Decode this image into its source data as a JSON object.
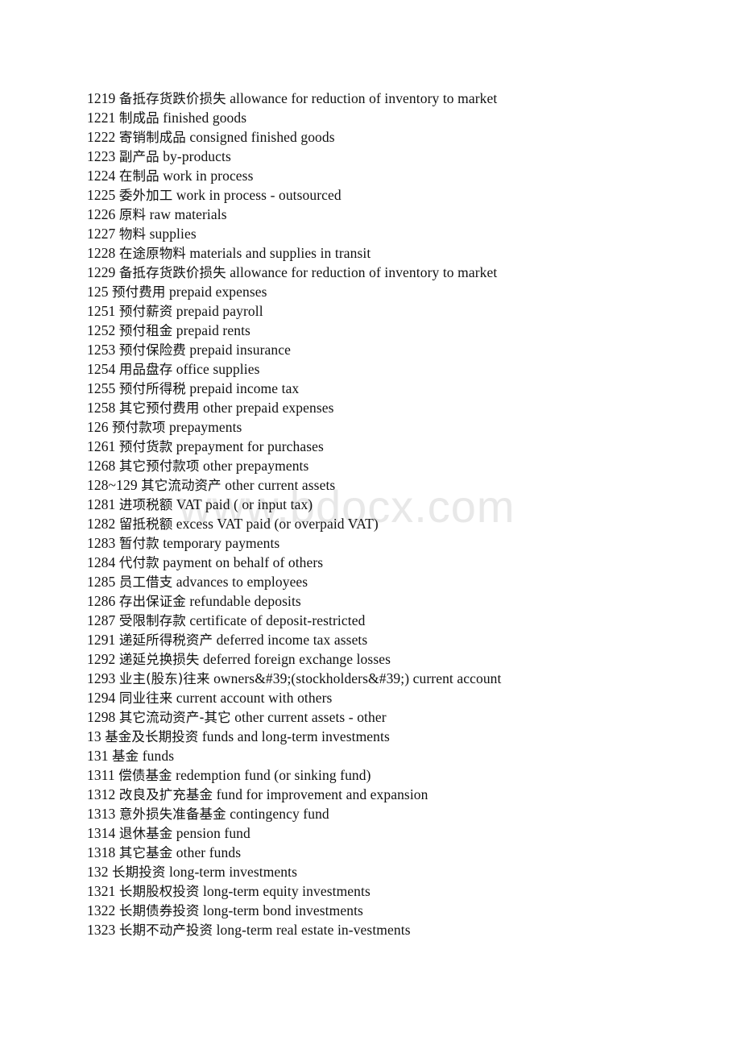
{
  "document": {
    "type": "accounting-chart-of-accounts-glossary",
    "language_pair": "Chinese-English",
    "watermark": {
      "text": "www.bdocx.com",
      "color": "#e8e8e8"
    },
    "entries": [
      {
        "code": "1219",
        "zh": "备抵存货跌价损失",
        "en": "allowance for reduction of inventory to market"
      },
      {
        "code": "1221",
        "zh": "制成品",
        "en": "finished goods"
      },
      {
        "code": "1222",
        "zh": "寄销制成品",
        "en": "consigned finished goods"
      },
      {
        "code": "1223",
        "zh": "副产品",
        "en": "by-products"
      },
      {
        "code": "1224",
        "zh": "在制品",
        "en": "work in process"
      },
      {
        "code": "1225",
        "zh": "委外加工",
        "en": "work in process - outsourced"
      },
      {
        "code": "1226",
        "zh": "原料",
        "en": "raw materials"
      },
      {
        "code": "1227",
        "zh": "物料",
        "en": "supplies"
      },
      {
        "code": "1228",
        "zh": "在途原物料",
        "en": "materials and supplies in transit"
      },
      {
        "code": "1229",
        "zh": "备抵存货跌价损失",
        "en": "allowance for reduction of inventory to market"
      },
      {
        "code": "125",
        "zh": "预付费用",
        "en": "prepaid expenses"
      },
      {
        "code": "1251",
        "zh": "预付薪资",
        "en": "prepaid payroll"
      },
      {
        "code": "1252",
        "zh": "预付租金",
        "en": "prepaid rents"
      },
      {
        "code": "1253",
        "zh": "预付保险费",
        "en": "prepaid insurance"
      },
      {
        "code": "1254",
        "zh": "用品盘存",
        "en": "office supplies"
      },
      {
        "code": "1255",
        "zh": "预付所得税",
        "en": "prepaid income tax"
      },
      {
        "code": "1258",
        "zh": "其它预付费用",
        "en": "other prepaid expenses"
      },
      {
        "code": "126",
        "zh": "预付款项",
        "en": "prepayments"
      },
      {
        "code": "1261",
        "zh": "预付货款",
        "en": "prepayment for purchases"
      },
      {
        "code": "1268",
        "zh": "其它预付款项",
        "en": "other prepayments"
      },
      {
        "code": "128~129",
        "zh": "其它流动资产",
        "en": "other current assets"
      },
      {
        "code": "1281",
        "zh": "进项税额",
        "en": "VAT paid ( or input tax)"
      },
      {
        "code": "1282",
        "zh": "留抵税额",
        "en": "excess VAT paid (or overpaid VAT)"
      },
      {
        "code": "1283",
        "zh": "暂付款",
        "en": "temporary payments"
      },
      {
        "code": "1284",
        "zh": "代付款",
        "en": "payment on behalf of others"
      },
      {
        "code": "1285",
        "zh": "员工借支",
        "en": "advances to employees"
      },
      {
        "code": "1286",
        "zh": "存出保证金",
        "en": "refundable deposits"
      },
      {
        "code": "1287",
        "zh": "受限制存款",
        "en": "certificate of deposit-restricted"
      },
      {
        "code": "1291",
        "zh": "递延所得税资产",
        "en": "deferred income tax assets"
      },
      {
        "code": "1292",
        "zh": "递延兑换损失",
        "en": "deferred foreign exchange losses"
      },
      {
        "code": "1293",
        "zh": "业主(股东)往来",
        "en": "owners&#39;(stockholders&#39;) current account"
      },
      {
        "code": "1294",
        "zh": "同业往来",
        "en": "current account with others"
      },
      {
        "code": "1298",
        "zh": "其它流动资产-其它",
        "en": "other current assets - other"
      },
      {
        "code": "13",
        "zh": "基金及长期投资",
        "en": "funds and long-term investments"
      },
      {
        "code": "131",
        "zh": "基金",
        "en": "funds"
      },
      {
        "code": "1311",
        "zh": "偿债基金",
        "en": "redemption fund (or sinking fund)"
      },
      {
        "code": "1312",
        "zh": "改良及扩充基金",
        "en": "fund for improvement and expansion"
      },
      {
        "code": "1313",
        "zh": "意外损失准备基金",
        "en": "contingency fund"
      },
      {
        "code": "1314",
        "zh": "退休基金",
        "en": "pension fund"
      },
      {
        "code": "1318",
        "zh": "其它基金",
        "en": "other funds"
      },
      {
        "code": "132",
        "zh": "长期投资",
        "en": "long-term investments"
      },
      {
        "code": "1321",
        "zh": "长期股权投资",
        "en": "long-term equity investments"
      },
      {
        "code": "1322",
        "zh": "长期债券投资",
        "en": "long-term bond investments"
      },
      {
        "code": "1323",
        "zh": "长期不动产投资",
        "en": "long-term real estate in-vestments"
      }
    ]
  }
}
